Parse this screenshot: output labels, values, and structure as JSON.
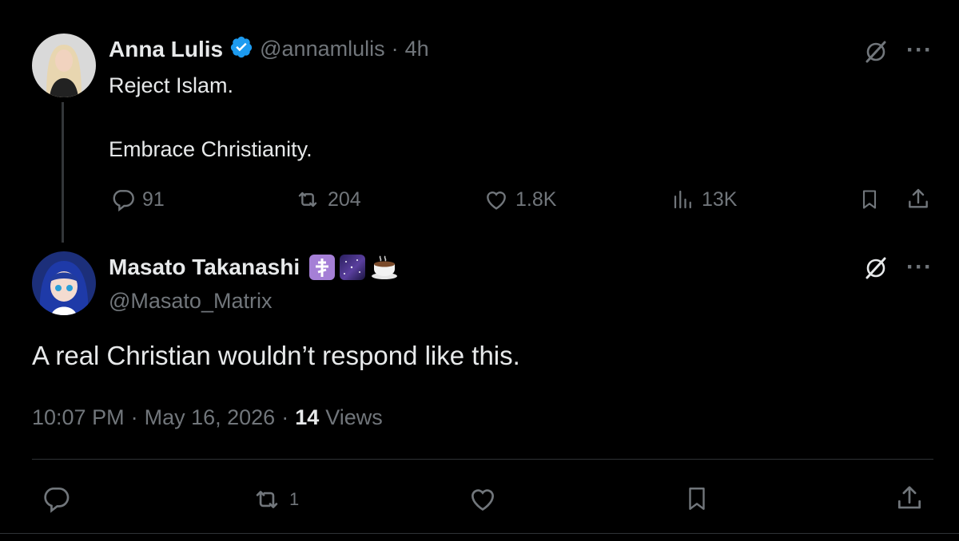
{
  "colors": {
    "background": "#000000",
    "text": "#e7e9ea",
    "muted": "#71767b",
    "verified": "#1d9bf0",
    "divider": "#2f3336"
  },
  "parent_tweet": {
    "author_name": "Anna Lulis",
    "verified": true,
    "handle": "@annamlulis",
    "separator": "·",
    "time": "4h",
    "text_line1": "Reject Islam.",
    "text_line2": "Embrace Christianity.",
    "replies": "91",
    "reposts": "204",
    "likes": "1.8K",
    "views": "13K",
    "icons": [
      "grok-icon",
      "more-icon",
      "reply-icon",
      "repost-icon",
      "like-icon",
      "views-icon",
      "bookmark-icon",
      "share-icon"
    ]
  },
  "main_tweet": {
    "author_name": "Masato Takanashi",
    "name_emojis": [
      "orthodox-cross-emoji",
      "milky-way-emoji",
      "hot-beverage-emoji"
    ],
    "handle": "@Masato_Matrix",
    "text": "A real Christian wouldn’t respond like this.",
    "timestamp_time": "10:07 PM",
    "separator": "·",
    "timestamp_date": "May 16, 2026",
    "views_count": "14",
    "views_label": "Views",
    "reposts": "1"
  }
}
